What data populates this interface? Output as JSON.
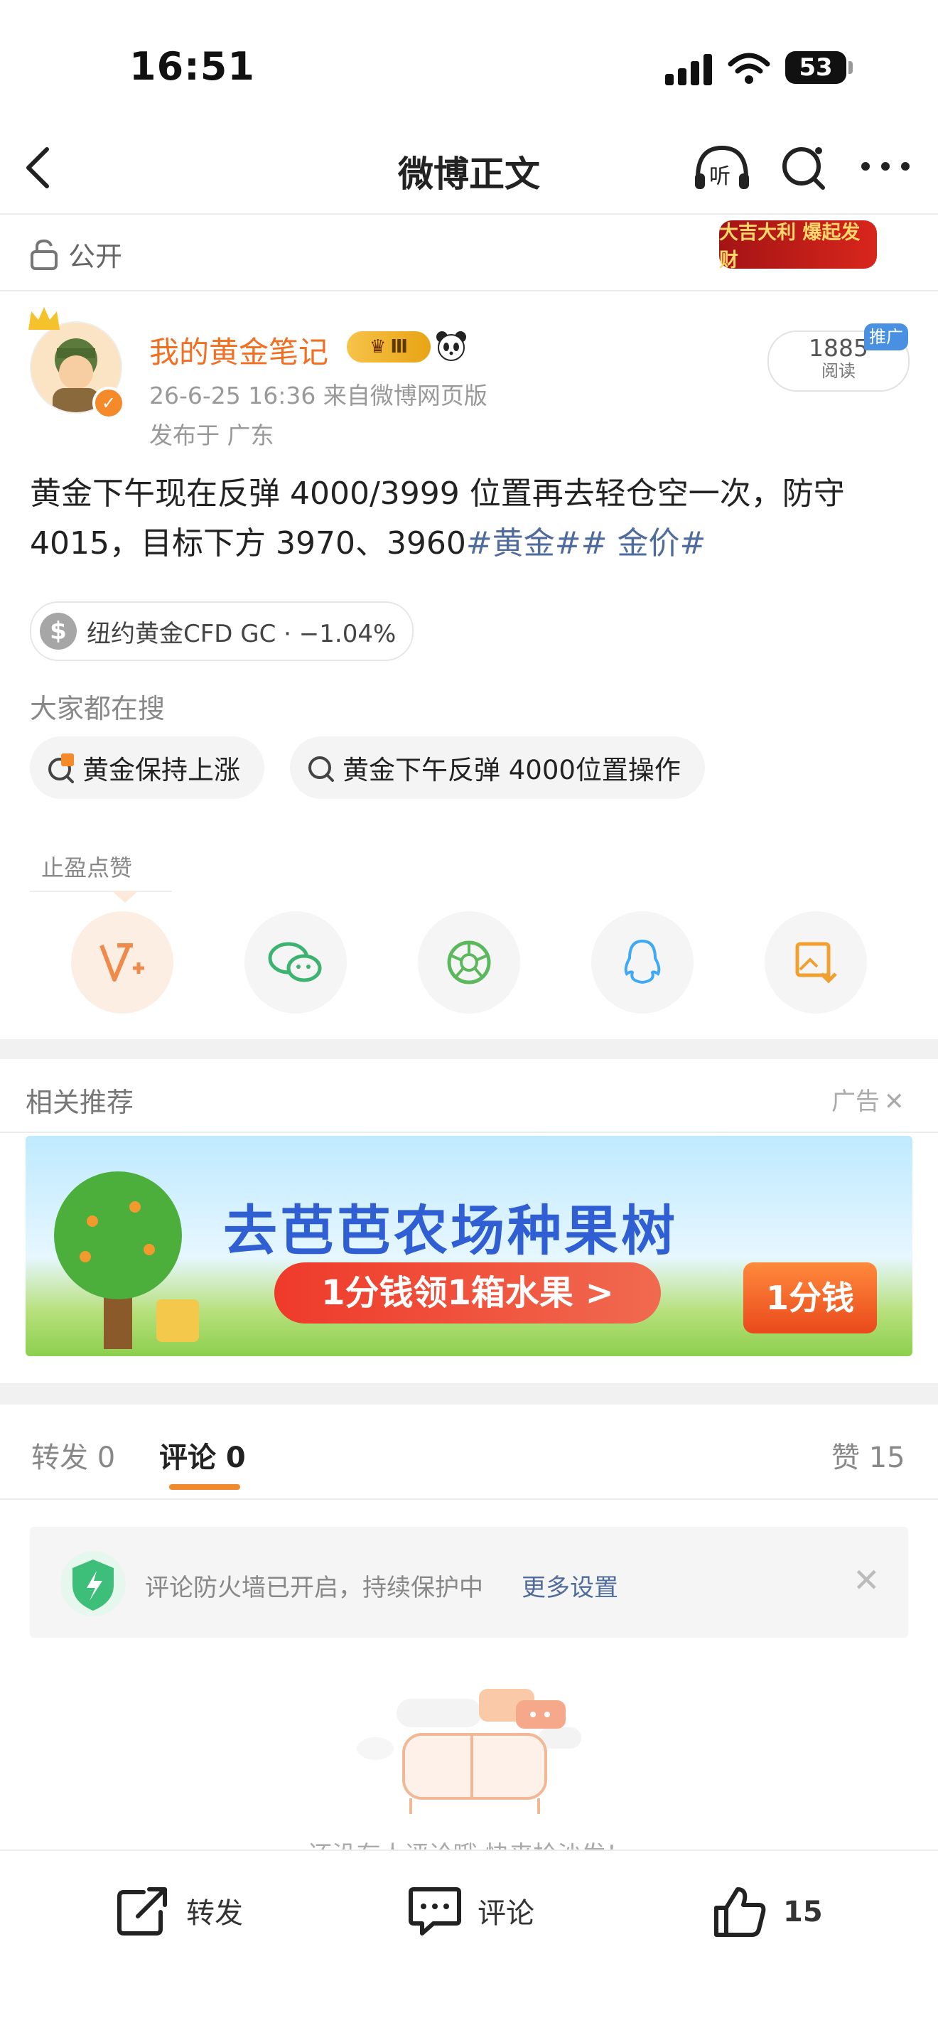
{
  "status_bar": {
    "time": "16:51",
    "battery": "53"
  },
  "nav": {
    "title": "微博正文"
  },
  "post": {
    "visibility": "公开",
    "banner_tag": "大吉大利 爆起发财",
    "author": "我的黄金笔记",
    "level_badge": "Ⅲ",
    "meta": "26-6-25 16:36  来自微博网页版",
    "location": "发布于 广东",
    "reads_count": "1885",
    "reads_label": "阅读",
    "promo_tag": "推广",
    "text": "黄金下午现在反弹 4000/3999 位置再去轻仓空一次，防守 4015，目标下方 3970、3960",
    "hashtags": "#黄金## 金价#",
    "stock_chip": "纽约黄金CFD GC · −1.04%",
    "stock_icon": "$"
  },
  "search": {
    "heading": "大家都在搜",
    "chips": [
      "黄金保持上涨",
      "黄金下午反弹 4000位置操作"
    ]
  },
  "like_caption": "止盈点赞",
  "share_icons": [
    "like-v-icon",
    "wechat-icon",
    "moments-icon",
    "qq-icon",
    "save-image-icon"
  ],
  "recommend": {
    "title": "相关推荐",
    "ad_label": "广告",
    "ad_headline": "去芭芭农场种果树",
    "ad_cta": "1分钱领1箱水果 >",
    "ad_price": "1分钱"
  },
  "tabs": {
    "repost": "转发 0",
    "comment": "评论 0",
    "likes": "赞 15"
  },
  "firewall": {
    "text": "评论防火墙已开启，持续保护中",
    "link": "更多设置"
  },
  "empty_state": "还没有人评论哦 快来抢沙发！",
  "bottom_bar": {
    "repost": "转发",
    "comment": "评论",
    "like": "15"
  },
  "colors": {
    "accent": "#f26f21",
    "link": "#4f6c9c",
    "underline": "#f08a2a"
  }
}
